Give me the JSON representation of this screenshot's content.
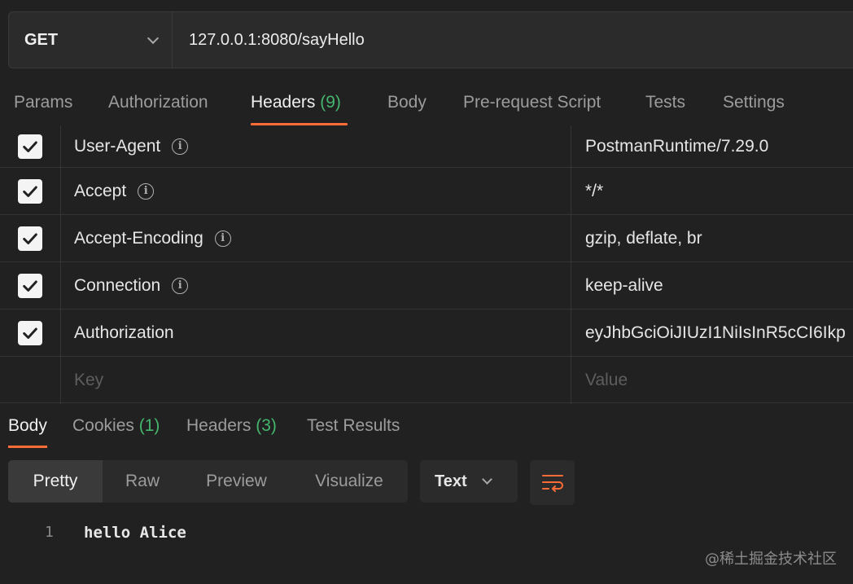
{
  "request": {
    "method": "GET",
    "url": "127.0.0.1:8080/sayHello"
  },
  "request_tabs": {
    "params": "Params",
    "authorization": "Authorization",
    "headers": "Headers",
    "headers_count": "(9)",
    "body": "Body",
    "prerequest": "Pre-request Script",
    "tests": "Tests",
    "settings": "Settings"
  },
  "headers": [
    {
      "key": "User-Agent",
      "value": "PostmanRuntime/7.29.0",
      "checked": true,
      "info": true
    },
    {
      "key": "Accept",
      "value": "*/*",
      "checked": true,
      "info": true
    },
    {
      "key": "Accept-Encoding",
      "value": "gzip, deflate, br",
      "checked": true,
      "info": true
    },
    {
      "key": "Connection",
      "value": "keep-alive",
      "checked": true,
      "info": true
    },
    {
      "key": "Authorization",
      "value": "eyJhbGciOiJIUzI1NiIsInR5cCI6Ikp",
      "checked": true,
      "info": false
    }
  ],
  "new_row": {
    "key_placeholder": "Key",
    "value_placeholder": "Value"
  },
  "response_tabs": {
    "body": "Body",
    "cookies": "Cookies",
    "cookies_count": "(1)",
    "headers": "Headers",
    "headers_count": "(3)",
    "test_results": "Test Results"
  },
  "view_modes": {
    "pretty": "Pretty",
    "raw": "Raw",
    "preview": "Preview",
    "visualize": "Visualize"
  },
  "format": "Text",
  "response_body": {
    "line_number": "1",
    "text": "hello Alice"
  },
  "watermark": "@稀土掘金技术社区",
  "colors": {
    "accent": "#ff6c37",
    "count_green": "#45b66d",
    "background": "#212121"
  }
}
